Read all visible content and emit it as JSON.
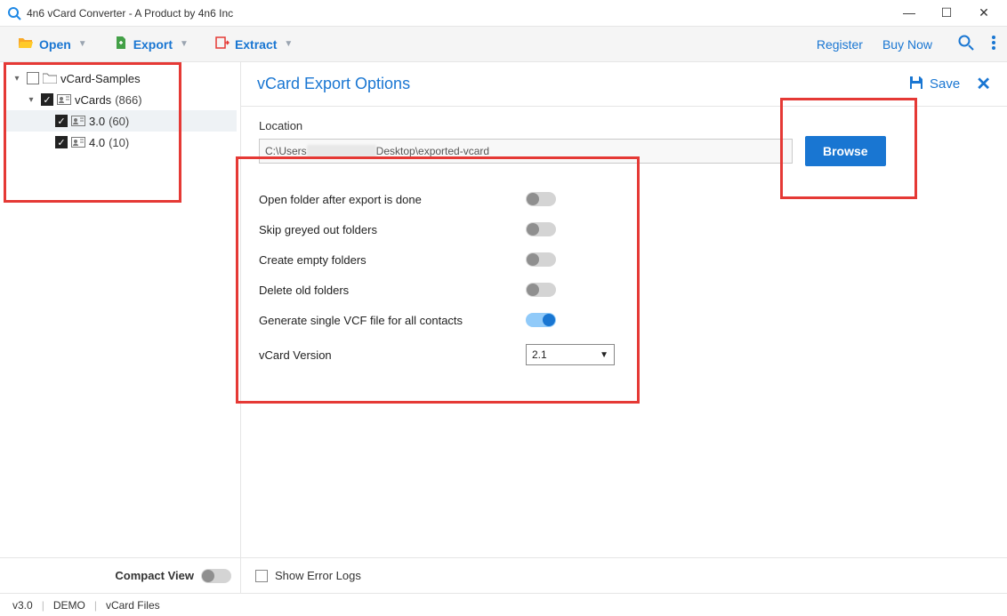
{
  "titlebar": {
    "title": "4n6 vCard Converter - A Product by 4n6 Inc"
  },
  "toolbar": {
    "open": "Open",
    "export": "Export",
    "extract": "Extract",
    "register": "Register",
    "buy": "Buy Now"
  },
  "sidebar": {
    "tree": {
      "root": {
        "label": "vCard-Samples",
        "checked": false
      },
      "vcards": {
        "label": "vCards",
        "count": "(866)",
        "checked": true
      },
      "v30": {
        "label": "3.0",
        "count": "(60)",
        "checked": true
      },
      "v40": {
        "label": "4.0",
        "count": "(10)",
        "checked": true
      }
    },
    "compact": "Compact View"
  },
  "panel": {
    "title": "vCard Export Options",
    "save": "Save",
    "location_label": "Location",
    "location_prefix": "C:\\Users",
    "location_suffix": "Desktop\\exported-vcard",
    "browse": "Browse",
    "opt_open_folder": "Open folder after export is done",
    "opt_skip_greyed": "Skip greyed out folders",
    "opt_create_empty": "Create empty folders",
    "opt_delete_old": "Delete old folders",
    "opt_single_vcf": "Generate single VCF file for all contacts",
    "version_label": "vCard Version",
    "version_value": "2.1",
    "show_error_logs": "Show Error Logs"
  },
  "status": {
    "version": "v3.0",
    "mode": "DEMO",
    "context": "vCard Files"
  }
}
